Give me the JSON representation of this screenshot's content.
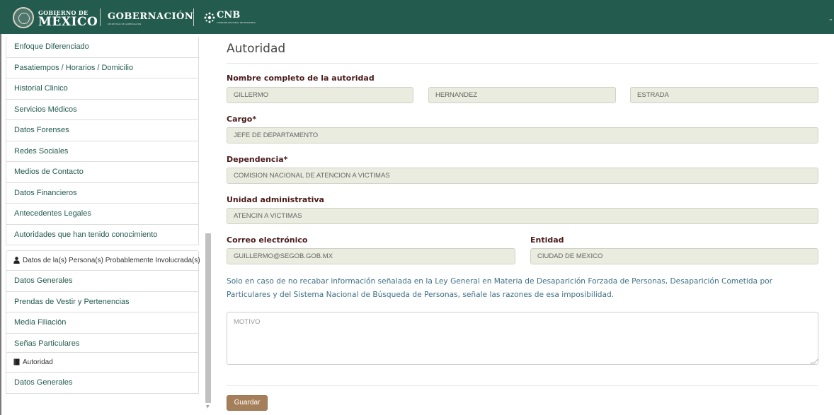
{
  "header": {
    "gob_top": "GOBIERNO DE",
    "gob_main": "MÉXICO",
    "gobernacion": "GOBERNACIÓN",
    "gobernacion_sub": "SECRETARÍA DE GOBERNACIÓN",
    "cnb_label": "CNB",
    "cnb_sub": "COMISIÓN NACIONAL DE BÚSQUEDA",
    "colors": {
      "brand": "#235b4e"
    }
  },
  "sidebar": {
    "items_top": [
      "Enfoque Diferenciado",
      "Pasatiempos / Horarios / Domicilio",
      "Historial Clinico",
      "Servicios Médicos",
      "Datos Forenses",
      "Redes Sociales",
      "Medios de Contacto",
      "Datos Financieros",
      "Antecedentes Legales",
      "Autoridades que han tenido conocimiento"
    ],
    "section_involved": "Datos de la(s) Persona(s) Probablemente Involucrada(s)",
    "items_involved": [
      "Datos Generales",
      "Prendas de Vestir y Pertenencias",
      "Media Filiación",
      "Señas Particulares"
    ],
    "section_authority": "Autoridad",
    "items_authority": [
      "Datos Generales"
    ]
  },
  "form": {
    "title": "Autoridad",
    "name_label": "Nombre completo de la autoridad",
    "first_name": "GILLERMO",
    "last_name_1": "HERNANDEZ",
    "last_name_2": "ESTRADA",
    "cargo_label": "Cargo*",
    "cargo_value": "JEFE DE DEPARTAMENTO",
    "dependencia_label": "Dependencia*",
    "dependencia_value": "COMISION NACIONAL DE ATENCION A VICTIMAS",
    "unidad_label": "Unidad administrativa",
    "unidad_value": "ATENCIN A VICTIMAS",
    "email_label": "Correo electrónico",
    "email_value": "GUILLERMO@SEGOB.GOB.MX",
    "entidad_label": "Entidad",
    "entidad_value": "CIUDAD DE MEXICO",
    "note": "Solo en caso de no recabar información señalada en la Ley General en Materia de Desaparición Forzada de Personas, Desaparición Cometida por Particulares y del Sistema Nacional de Búsqueda de Personas, señale las razones de esa imposibilidad.",
    "motivo_placeholder": "MOTIVO",
    "save_label": "Guardar",
    "colors": {
      "button": "#a57f5a",
      "label": "#4a1a1a",
      "note": "#3d6f86",
      "link": "#235b4e"
    }
  }
}
